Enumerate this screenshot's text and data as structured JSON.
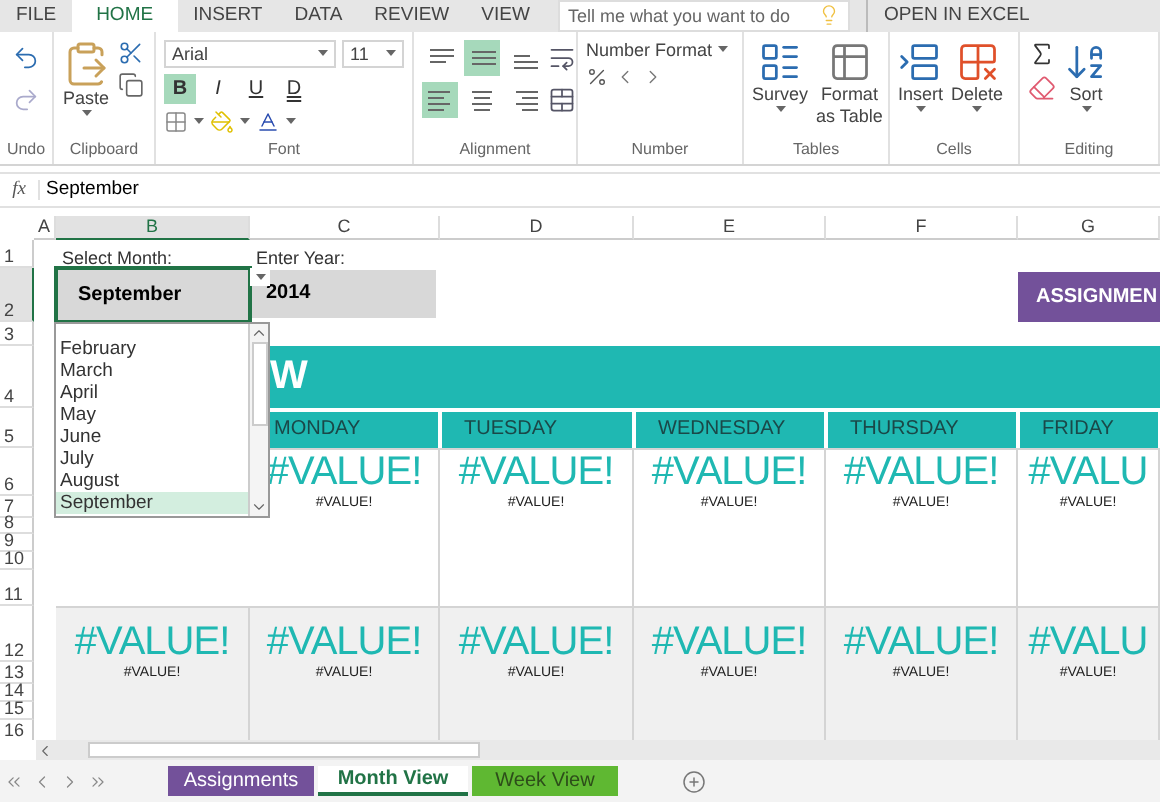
{
  "menu_tabs": [
    {
      "label": "FILE",
      "selected": false
    },
    {
      "label": "HOME",
      "selected": true
    },
    {
      "label": "INSERT",
      "selected": false
    },
    {
      "label": "DATA",
      "selected": false
    },
    {
      "label": "REVIEW",
      "selected": false
    },
    {
      "label": "VIEW",
      "selected": false
    }
  ],
  "search": {
    "placeholder": "Tell me what you want to do"
  },
  "open_in_excel": "OPEN IN EXCEL",
  "ribbon": {
    "undo_label": "Undo",
    "clipboard": {
      "paste": "Paste",
      "label": "Clipboard"
    },
    "font": {
      "name": "Arial",
      "size": "11",
      "styles": [
        {
          "label": "B",
          "selected": true
        },
        {
          "label": "I",
          "selected": false
        },
        {
          "label": "U",
          "selected": false
        },
        {
          "label": "D",
          "selected": false
        }
      ],
      "label": "Font"
    },
    "alignment": {
      "buttons": [
        {
          "kind": "top",
          "selected": false
        },
        {
          "kind": "middle",
          "selected": true
        },
        {
          "kind": "bottom",
          "selected": false
        },
        {
          "kind": "left",
          "selected": true
        },
        {
          "kind": "center",
          "selected": false
        },
        {
          "kind": "right",
          "selected": false
        }
      ],
      "label": "Alignment"
    },
    "number": {
      "format": "Number Format",
      "label": "Number"
    },
    "tables": {
      "survey": "Survey",
      "format_line1": "Format",
      "format_line2": "as Table",
      "label": "Tables"
    },
    "cells": {
      "insert": "Insert",
      "delete": "Delete",
      "label": "Cells"
    },
    "editing": {
      "sort": "Sort",
      "label": "Editing"
    }
  },
  "formula_bar": {
    "fx": "fx",
    "value": "September"
  },
  "columns": [
    {
      "label": "A",
      "selected": false
    },
    {
      "label": "B",
      "selected": true
    },
    {
      "label": "C",
      "selected": false
    },
    {
      "label": "D",
      "selected": false
    },
    {
      "label": "E",
      "selected": false
    },
    {
      "label": "F",
      "selected": false
    },
    {
      "label": "G",
      "selected": false
    }
  ],
  "rows": [
    {
      "label": "1",
      "selected": false
    },
    {
      "label": "2",
      "selected": true
    },
    {
      "label": "3",
      "selected": false
    },
    {
      "label": "4",
      "selected": false
    },
    {
      "label": "5",
      "selected": false
    },
    {
      "label": "6",
      "selected": false
    },
    {
      "label": "7",
      "selected": false
    },
    {
      "label": "8",
      "selected": false
    },
    {
      "label": "9",
      "selected": false
    },
    {
      "label": "10",
      "selected": false
    },
    {
      "label": "11",
      "selected": false
    },
    {
      "label": "12",
      "selected": false
    },
    {
      "label": "13",
      "selected": false
    },
    {
      "label": "14",
      "selected": false
    },
    {
      "label": "15",
      "selected": false
    },
    {
      "label": "16",
      "selected": false
    }
  ],
  "month_label": "Select Month:",
  "year_label": "Enter Year:",
  "month_value": "September",
  "year_value": "2014",
  "assignments_button": "ASSIGNMEN",
  "calendar": {
    "title": "W",
    "day_headers": [
      "MONDAY",
      "TUESDAY",
      "WEDNESDAY",
      "THURSDAY",
      "FRIDAY"
    ],
    "weeks": [
      {
        "cells": [
          {
            "date": "#VALUE!",
            "note": "#VALUE!"
          },
          {
            "date": "#VALUE!",
            "note": "#VALUE!"
          },
          {
            "date": "#VALUE!",
            "note": "#VALUE!"
          },
          {
            "date": "#VALUE!",
            "note": "#VALUE!"
          },
          {
            "date": "#VALU",
            "note": "#VALUE!"
          }
        ]
      },
      {
        "cells": [
          {
            "date": "#VALUE!",
            "note": "#VALUE!"
          },
          {
            "date": "#VALUE!",
            "note": "#VALUE!"
          },
          {
            "date": "#VALUE!",
            "note": "#VALUE!"
          },
          {
            "date": "#VALUE!",
            "note": "#VALUE!"
          },
          {
            "date": "#VALUE!",
            "note": "#VALUE!"
          },
          {
            "date": "#VALU",
            "note": "#VALUE!"
          }
        ]
      }
    ]
  },
  "month_dropdown": [
    {
      "label": "February",
      "selected": false
    },
    {
      "label": "March",
      "selected": false
    },
    {
      "label": "April",
      "selected": false
    },
    {
      "label": "May",
      "selected": false
    },
    {
      "label": "June",
      "selected": false
    },
    {
      "label": "July",
      "selected": false
    },
    {
      "label": "August",
      "selected": false
    },
    {
      "label": "September",
      "selected": true
    }
  ],
  "sheet_tabs": [
    {
      "label": "Assignments",
      "selected": false,
      "color": "#73519a"
    },
    {
      "label": "Month View",
      "selected": true,
      "color": "#217346"
    },
    {
      "label": "Week View",
      "selected": false,
      "color": "#5fb832"
    }
  ]
}
